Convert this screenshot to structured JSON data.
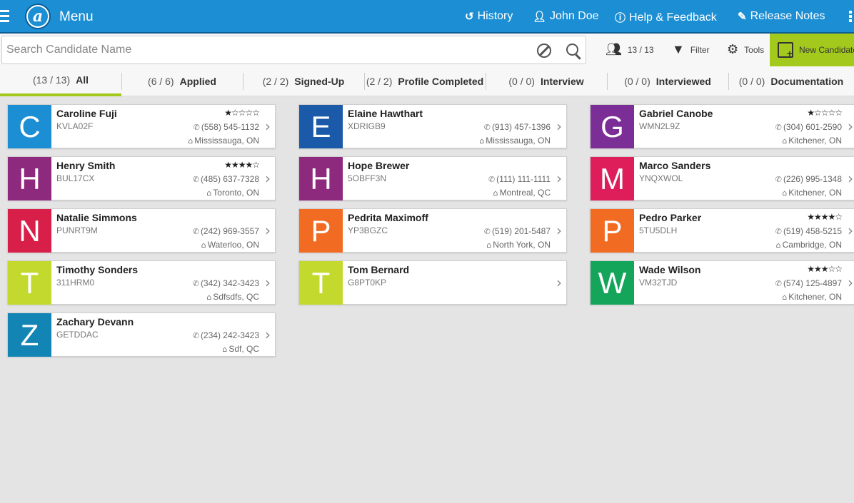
{
  "header": {
    "menu_label": "Menu",
    "logo_letter": "a",
    "nav": [
      {
        "icon": "history-icon",
        "label": "History"
      },
      {
        "icon": "user-icon",
        "label": "John Doe"
      },
      {
        "icon": "feedback-icon",
        "label": "Help & Feedback"
      },
      {
        "icon": "edit-icon",
        "label": "Release Notes"
      }
    ]
  },
  "toolbar": {
    "search_placeholder": "Search Candidate Name",
    "count": "13 / 13",
    "filter_label": "Filter",
    "tools_label": "Tools",
    "new_candidate_label": "New Candidate"
  },
  "tabs": [
    {
      "count": "(13 / 13)",
      "label": "All"
    },
    {
      "count": "(6 / 6)",
      "label": "Applied"
    },
    {
      "count": "(2 / 2)",
      "label": "Signed-Up"
    },
    {
      "count": "(2 / 2)",
      "label": "Profile Completed"
    },
    {
      "count": "(0 / 0)",
      "label": "Interview"
    },
    {
      "count": "(0 / 0)",
      "label": "Interviewed"
    },
    {
      "count": "(0 / 0)",
      "label": "Documentation"
    }
  ],
  "candidates": [
    {
      "letter": "C",
      "color": "#1b8ed4",
      "name": "Caroline Fuji",
      "code": "KVLA02F",
      "stars": "★☆☆☆☆",
      "phone": "(558) 545-1132",
      "location": "Mississauga, ON"
    },
    {
      "letter": "E",
      "color": "#1a5aa8",
      "name": "Elaine Hawthart",
      "code": "XDRIGB9",
      "stars": "",
      "phone": "(913) 457-1396",
      "location": "Mississauga, ON"
    },
    {
      "letter": "G",
      "color": "#7b2f96",
      "name": "Gabriel Canobe",
      "code": "WMN2L9Z",
      "stars": "★☆☆☆☆",
      "phone": "(304) 601-2590",
      "location": "Kitchener, ON"
    },
    {
      "letter": "H",
      "color": "#8e2a7d",
      "name": "Henry Smith",
      "code": "BUL17CX",
      "stars": "★★★★☆",
      "phone": "(485) 637-7328",
      "location": "Toronto, ON"
    },
    {
      "letter": "H",
      "color": "#8e2a7d",
      "name": "Hope Brewer",
      "code": "5OBFF3N",
      "stars": "",
      "phone": "(111) 111-1111",
      "location": "Montreal, QC"
    },
    {
      "letter": "M",
      "color": "#de1e5a",
      "name": "Marco Sanders",
      "code": "YNQXWOL",
      "stars": "",
      "phone": "(226) 995-1348",
      "location": "Kitchener, ON"
    },
    {
      "letter": "N",
      "color": "#d81f49",
      "name": "Natalie Simmons",
      "code": "PUNRT9M",
      "stars": "",
      "phone": "(242) 969-3557",
      "location": "Waterloo, ON"
    },
    {
      "letter": "P",
      "color": "#f26b22",
      "name": "Pedrita Maximoff",
      "code": "YP3BGZC",
      "stars": "",
      "phone": "(519) 201-5487",
      "location": "North York, ON"
    },
    {
      "letter": "P",
      "color": "#f26b22",
      "name": "Pedro Parker",
      "code": "5TU5DLH",
      "stars": "★★★★☆",
      "phone": "(519) 458-5215",
      "location": "Cambridge, ON"
    },
    {
      "letter": "T",
      "color": "#c3d92d",
      "name": "Timothy Sonders",
      "code": "311HRM0",
      "stars": "",
      "phone": "(342) 342-3423",
      "location": "Sdfsdfs, QC"
    },
    {
      "letter": "T",
      "color": "#c3d92d",
      "name": "Tom Bernard",
      "code": "G8PT0KP",
      "stars": "",
      "phone": "",
      "location": ""
    },
    {
      "letter": "W",
      "color": "#15a55a",
      "name": "Wade Wilson",
      "code": "VM32TJD",
      "stars": "★★★☆☆",
      "phone": "(574) 125-4897",
      "location": "Kitchener, ON"
    },
    {
      "letter": "Z",
      "color": "#1385b5",
      "name": "Zachary Devann",
      "code": "GETDDAC",
      "stars": "",
      "phone": "(234) 242-3423",
      "location": "Sdf, QC"
    }
  ]
}
